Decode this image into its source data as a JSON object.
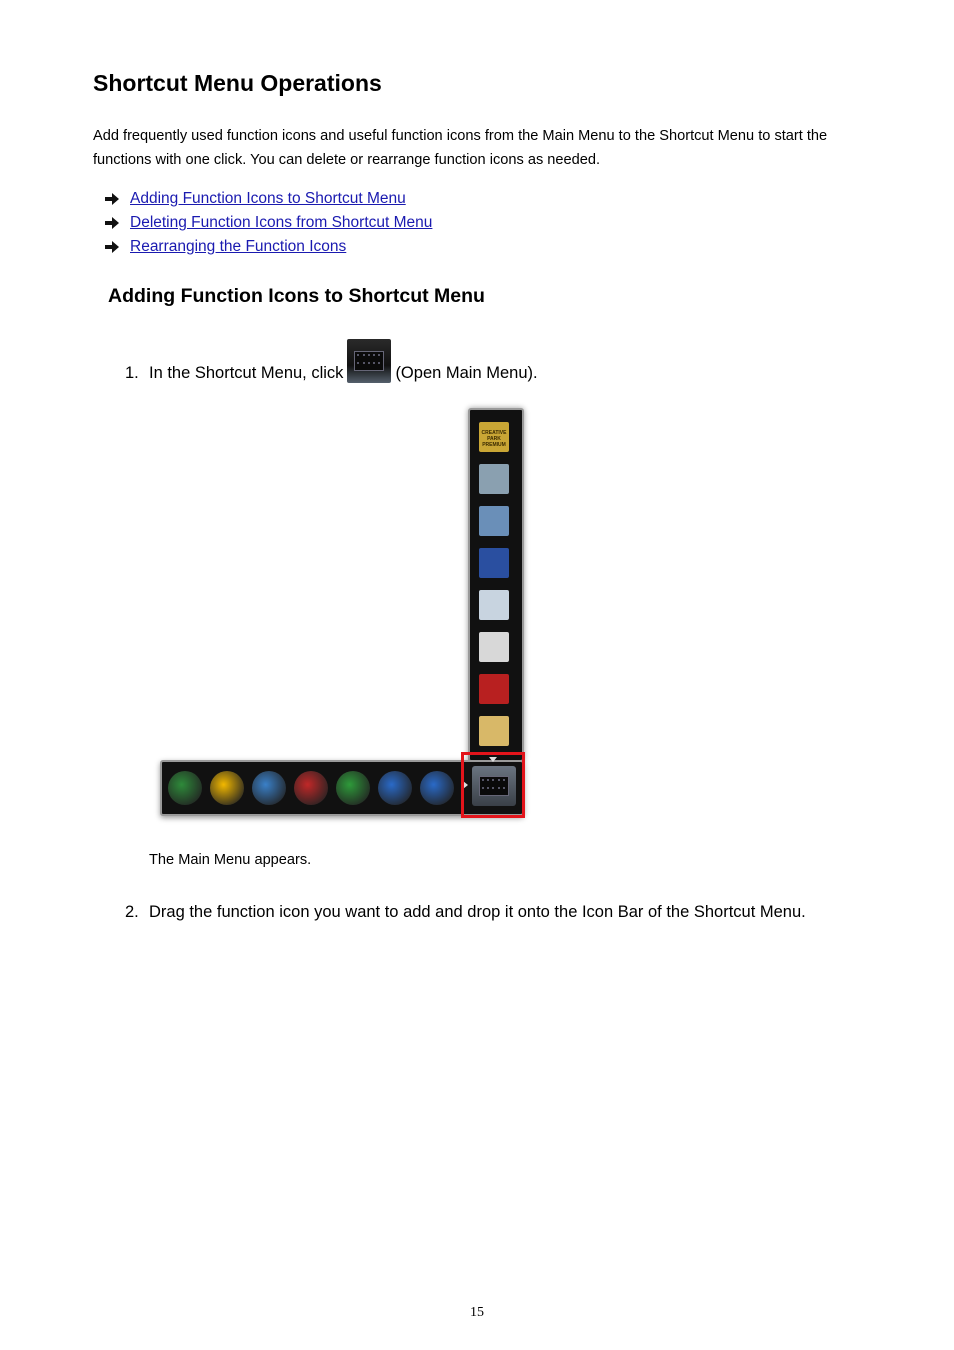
{
  "page": {
    "title": "Shortcut Menu Operations",
    "intro": "Add frequently used function icons and useful function icons from the Main Menu to the Shortcut Menu to start the functions with one click. You can delete or rearrange function icons as needed.",
    "toc": [
      {
        "label": "Adding Function Icons to Shortcut Menu",
        "icon": "arrow-right-icon"
      },
      {
        "label": "Deleting Function Icons from Shortcut Menu",
        "icon": "arrow-right-icon"
      },
      {
        "label": "Rearranging the Function Icons",
        "icon": "arrow-right-icon"
      }
    ],
    "page_number": "15"
  },
  "section": {
    "title": "Adding Function Icons to Shortcut Menu",
    "steps": [
      {
        "number": "1.",
        "text_before": "In the Shortcut Menu, click",
        "icon": "open-main-menu-icon",
        "text_after": "(Open Main Menu).",
        "result": "The Main Menu appears."
      },
      {
        "number": "2.",
        "text": "Drag the function icon you want to add and drop it onto the Icon Bar of the Shortcut Menu."
      }
    ]
  },
  "figure": {
    "vertical_bar_icons": [
      {
        "name": "creative-park-premium-icon",
        "label": "CREATIVE PARK PREMIUM",
        "color": "#c9a635"
      },
      {
        "name": "scanner-tools-icon",
        "color": "#8aa0b0"
      },
      {
        "name": "photo-scan-icon",
        "color": "#6a8fb8"
      },
      {
        "name": "photo-film-icon",
        "color": "#2a4fa0"
      },
      {
        "name": "photo-layout-icon",
        "color": "#c8d4e0"
      },
      {
        "name": "disc-label-icon",
        "color": "#d8d8d8"
      },
      {
        "name": "photo-print-icon",
        "color": "#b82020"
      },
      {
        "name": "photo-edit-icon",
        "color": "#d8b868"
      }
    ],
    "horizontal_bar_icons": [
      {
        "name": "web-manual-icon",
        "color": "#2e8a3a"
      },
      {
        "name": "wireless-icon",
        "color": "#f2b800"
      },
      {
        "name": "ink-info-icon",
        "color": "#3a80c8"
      },
      {
        "name": "shopping-cart-icon",
        "color": "#c02828"
      },
      {
        "name": "printer-user-icon",
        "color": "#2e9a3a"
      },
      {
        "name": "help-icon",
        "color": "#2a6ac8"
      },
      {
        "name": "online-help-icon",
        "color": "#2a6ac8"
      }
    ],
    "highlight_color": "#e3141b",
    "main_menu_button": "open-main-menu-icon"
  }
}
